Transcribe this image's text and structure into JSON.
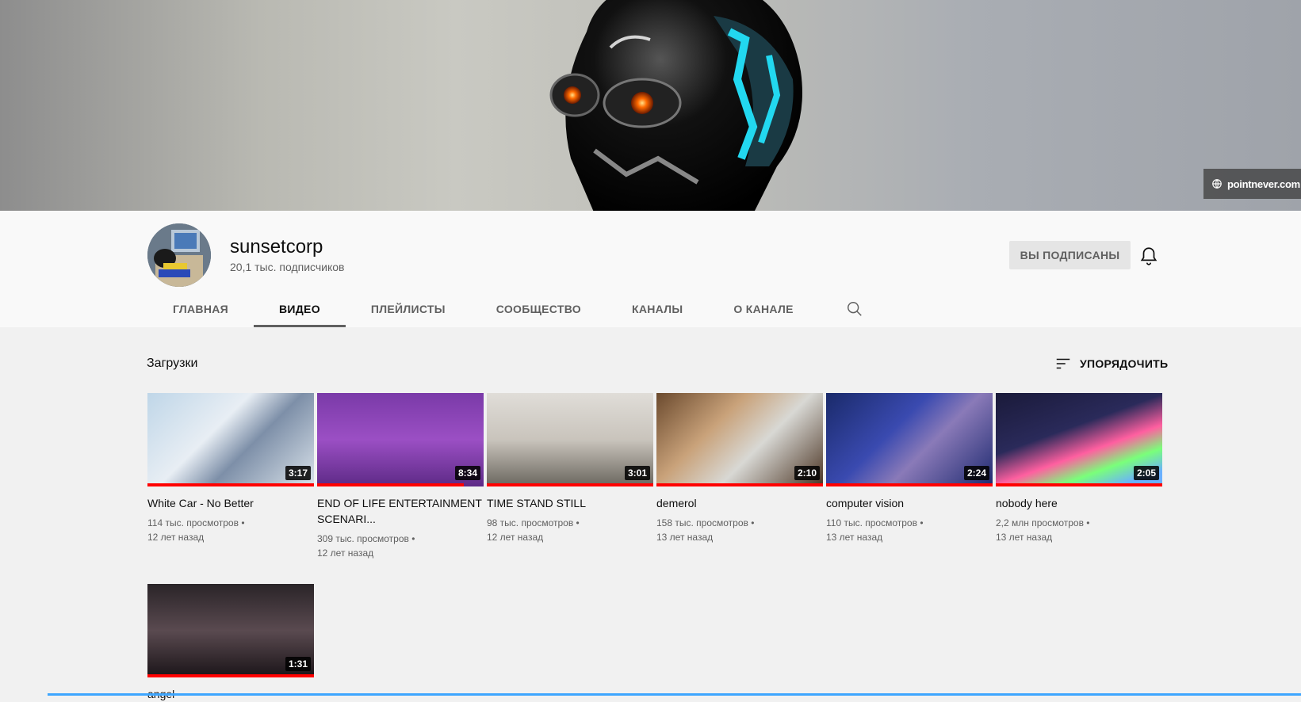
{
  "banner": {
    "link_text": "pointnever.com",
    "link_icon": "globe-icon"
  },
  "channel": {
    "name": "sunsetcorp",
    "subscribers": "20,1 тыс. подписчиков",
    "subscribe_label": "ВЫ ПОДПИСАНЫ",
    "bell_icon": "bell-icon"
  },
  "tabs": [
    {
      "label": "ГЛАВНАЯ"
    },
    {
      "label": "ВИДЕО"
    },
    {
      "label": "ПЛЕЙЛИСТЫ"
    },
    {
      "label": "СООБЩЕСТВО"
    },
    {
      "label": "КАНАЛЫ"
    },
    {
      "label": "О КАНАЛЕ"
    }
  ],
  "active_tab": "ВИДЕО",
  "section": {
    "title": "Загрузки",
    "sort_label": "УПОРЯДОЧИТЬ"
  },
  "videos": [
    {
      "title": "White Car - No Better",
      "views": "114 тыс. просмотров",
      "age": "12 лет назад",
      "duration": "3:17",
      "watched": 1.0
    },
    {
      "title": "END OF LIFE ENTERTAINMENT SCENARI...",
      "views": "309 тыс. просмотров",
      "age": "12 лет назад",
      "duration": "8:34",
      "watched": 0.88
    },
    {
      "title": "TIME STAND STILL",
      "views": "98 тыс. просмотров",
      "age": "12 лет назад",
      "duration": "3:01",
      "watched": 1.0
    },
    {
      "title": "demerol",
      "views": "158 тыс. просмотров",
      "age": "13 лет назад",
      "duration": "2:10",
      "watched": 1.0
    },
    {
      "title": "computer vision",
      "views": "110 тыс. просмотров",
      "age": "13 лет назад",
      "duration": "2:24",
      "watched": 1.0
    },
    {
      "title": "nobody here",
      "views": "2,2 млн просмотров",
      "age": "13 лет назад",
      "duration": "2:05",
      "watched": 1.0
    },
    {
      "title": "angel",
      "views": "",
      "age": "",
      "duration": "1:31",
      "watched": 1.0
    }
  ],
  "colors": {
    "accent": "#ff0000",
    "text": "#0f0f0f",
    "secondary": "#606060"
  }
}
